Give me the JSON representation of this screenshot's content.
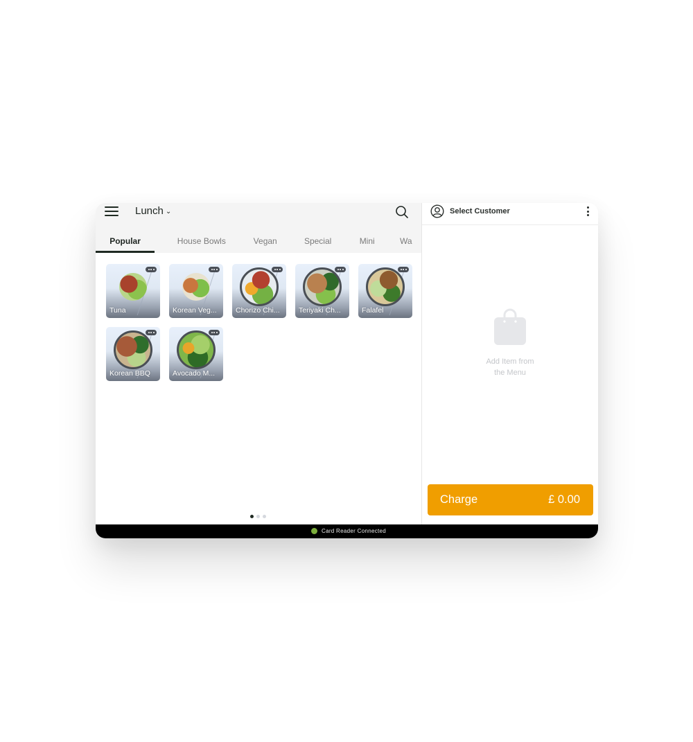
{
  "header": {
    "menu_name": "Lunch",
    "menu_dropdown_icon": "chevron-down-icon",
    "hamburger_icon": "hamburger-menu-icon",
    "search_icon": "search-icon"
  },
  "tabs": [
    {
      "label": "Popular",
      "active": true
    },
    {
      "label": "House Bowls",
      "active": false
    },
    {
      "label": "Vegan",
      "active": false
    },
    {
      "label": "Special",
      "active": false
    },
    {
      "label": "Mini",
      "active": false
    },
    {
      "label": "Wa",
      "active": false
    }
  ],
  "items": [
    {
      "label": "Tuna"
    },
    {
      "label": "Korean Veg..."
    },
    {
      "label": "Chorizo Chi..."
    },
    {
      "label": "Teriyaki Ch..."
    },
    {
      "label": "Falafel"
    },
    {
      "label": "Korean BBQ"
    },
    {
      "label": "Avocado M..."
    }
  ],
  "pager": {
    "pages": 3,
    "current": 1
  },
  "customer": {
    "label": "Select Customer",
    "icon": "user-circle-icon",
    "more_icon": "kebab-menu-icon"
  },
  "cart": {
    "empty_icon": "shopping-bag-icon",
    "empty_line1": "Add Item from",
    "empty_line2": "the Menu"
  },
  "charge": {
    "label": "Charge",
    "amount": "£ 0.00",
    "color": "#f09e00"
  },
  "status": {
    "text": "Card Reader Connected",
    "indicator_color": "#7cae3c"
  }
}
